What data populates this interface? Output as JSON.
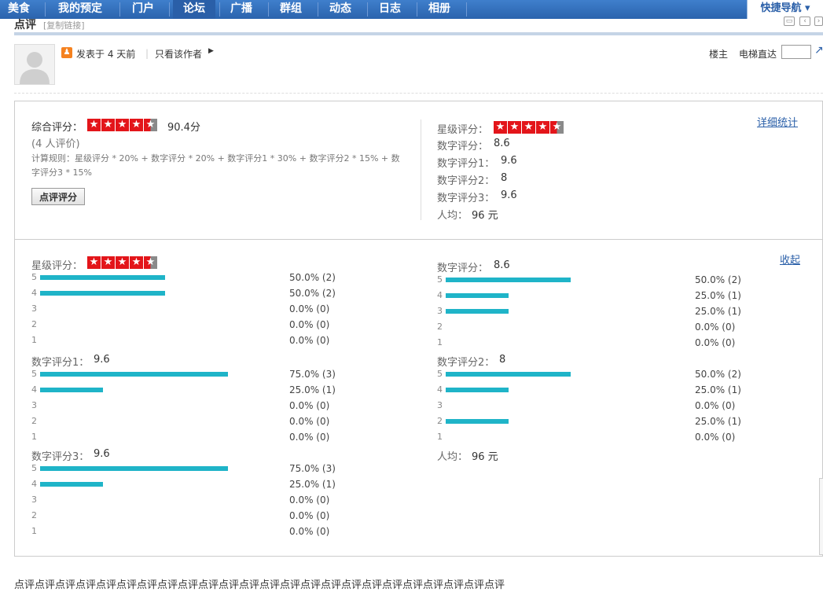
{
  "nav": {
    "items": [
      {
        "label": "美食",
        "active": false
      },
      {
        "label": "我的预定",
        "active": false
      },
      {
        "label": "门户",
        "active": false
      },
      {
        "label": "论坛",
        "active": true
      },
      {
        "label": "广播",
        "active": false
      },
      {
        "label": "群组",
        "active": false
      },
      {
        "label": "动态",
        "active": false
      },
      {
        "label": "日志",
        "active": false
      },
      {
        "label": "相册",
        "active": false
      }
    ],
    "quick_nav": "快捷导航 ▾"
  },
  "section": {
    "title": "点评",
    "copy_link": "[复制链接]"
  },
  "post": {
    "posted": "发表于 4 天前",
    "author_only": "只看该作者",
    "floor": "楼主",
    "elevator": "电梯直达"
  },
  "summary": {
    "overall_label": "综合评分：",
    "overall_score": "90.4分",
    "overall_stars": 4.5,
    "raters": "(4 人评价)",
    "rule": "计算规则：星级评分 * 20% + 数字评分 * 20% + 数字评分1 * 30% + 数字评分2 * 15% + 数字评分3 * 15%",
    "rate_button": "点评评分",
    "detail_link": "详细统计",
    "right": {
      "star_label": "星级评分：",
      "star_rating": 4.5,
      "lines": [
        {
          "label": "数字评分：",
          "value": "8.6"
        },
        {
          "label": "数字评分1：",
          "value": "9.6"
        },
        {
          "label": "数字评分2：",
          "value": "8"
        },
        {
          "label": "数字评分3：",
          "value": "9.6"
        },
        {
          "label": "人均：",
          "value": "96 元"
        }
      ]
    }
  },
  "detail": {
    "collapse_link": "收起",
    "groups": [
      {
        "title_label": "星级评分：",
        "title_value": "",
        "stars": 4.5,
        "rows": [
          {
            "level": "5",
            "fraction": 0.5,
            "text": "50.0% (2)"
          },
          {
            "level": "4",
            "fraction": 0.5,
            "text": "50.0% (2)"
          },
          {
            "level": "3",
            "fraction": 0,
            "text": "0.0% (0)"
          },
          {
            "level": "2",
            "fraction": 0,
            "text": "0.0% (0)"
          },
          {
            "level": "1",
            "fraction": 0,
            "text": "0.0% (0)"
          }
        ]
      },
      {
        "title_label": "数字评分：",
        "title_value": "8.6",
        "rows": [
          {
            "level": "5",
            "fraction": 0.5,
            "text": "50.0% (2)"
          },
          {
            "level": "4",
            "fraction": 0.25,
            "text": "25.0% (1)"
          },
          {
            "level": "3",
            "fraction": 0.25,
            "text": "25.0% (1)"
          },
          {
            "level": "2",
            "fraction": 0,
            "text": "0.0% (0)"
          },
          {
            "level": "1",
            "fraction": 0,
            "text": "0.0% (0)"
          }
        ]
      },
      {
        "title_label": "数字评分1：",
        "title_value": "9.6",
        "rows": [
          {
            "level": "5",
            "fraction": 0.75,
            "text": "75.0% (3)"
          },
          {
            "level": "4",
            "fraction": 0.25,
            "text": "25.0% (1)"
          },
          {
            "level": "3",
            "fraction": 0,
            "text": "0.0% (0)"
          },
          {
            "level": "2",
            "fraction": 0,
            "text": "0.0% (0)"
          },
          {
            "level": "1",
            "fraction": 0,
            "text": "0.0% (0)"
          }
        ]
      },
      {
        "title_label": "数字评分2：",
        "title_value": "8",
        "rows": [
          {
            "level": "5",
            "fraction": 0.5,
            "text": "50.0% (2)"
          },
          {
            "level": "4",
            "fraction": 0.25,
            "text": "25.0% (1)"
          },
          {
            "level": "3",
            "fraction": 0,
            "text": "0.0% (0)"
          },
          {
            "level": "2",
            "fraction": 0.25,
            "text": "25.0% (1)"
          },
          {
            "level": "1",
            "fraction": 0,
            "text": "0.0% (0)"
          }
        ]
      },
      {
        "title_label": "数字评分3：",
        "title_value": "9.6",
        "rows": [
          {
            "level": "5",
            "fraction": 0.75,
            "text": "75.0% (3)"
          },
          {
            "level": "4",
            "fraction": 0.25,
            "text": "25.0% (1)"
          },
          {
            "level": "3",
            "fraction": 0,
            "text": "0.0% (0)"
          },
          {
            "level": "2",
            "fraction": 0,
            "text": "0.0% (0)"
          },
          {
            "level": "1",
            "fraction": 0,
            "text": "0.0% (0)"
          }
        ]
      }
    ],
    "per_capita": {
      "label": "人均：",
      "value": "96 元"
    }
  },
  "body_text": "点评点评点评点评点评点评点评点评点评点评点评点评点评点评点评点评点评点评点评点评点评点评点评点评"
}
